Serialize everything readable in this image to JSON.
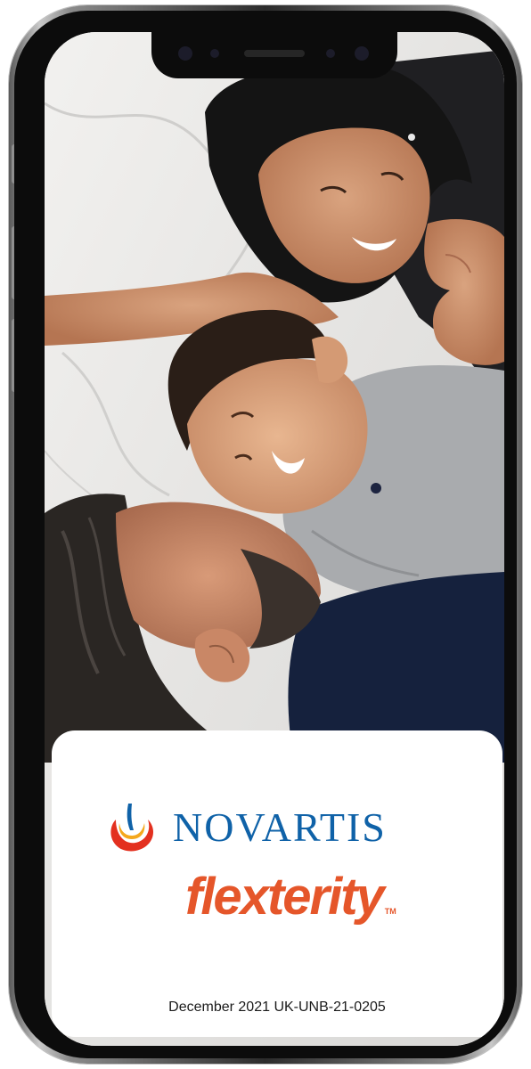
{
  "brand": {
    "company_logo": "novartis-logo",
    "company_name": "NOVARTIS",
    "product_name": "flexterity",
    "trademark": "TM"
  },
  "footer": {
    "code": "December 2021 UK-UNB-21-0205"
  },
  "colors": {
    "novartis_blue": "#0f62a8",
    "flexterity_orange": "#e5562a",
    "logo_yellow": "#f4a81d",
    "logo_red": "#e3301f"
  }
}
